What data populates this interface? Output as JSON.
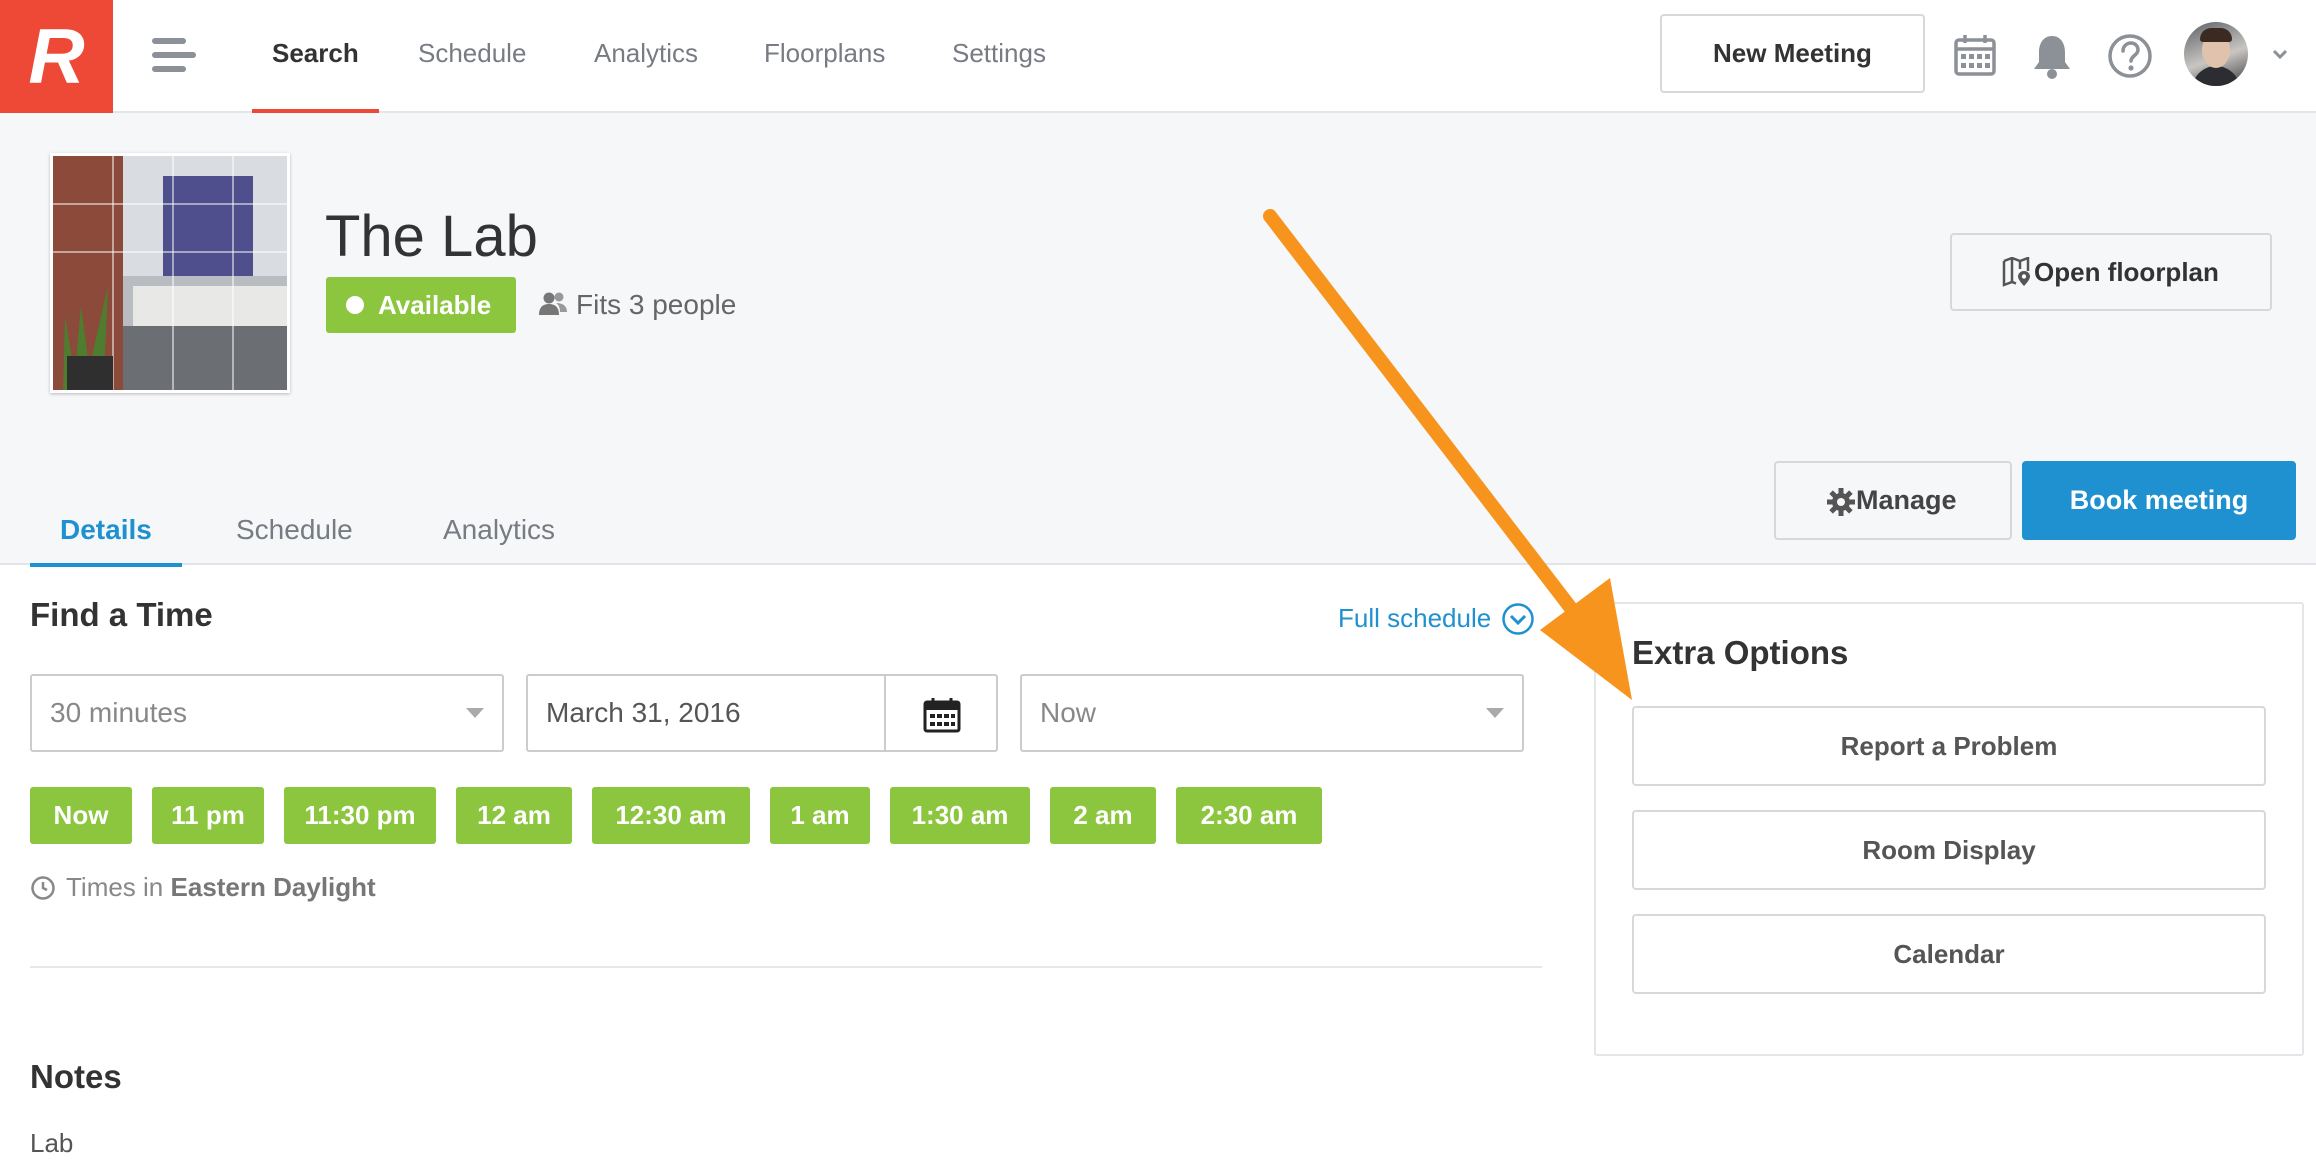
{
  "app": {
    "logo_letter": "R",
    "accent": "#ee4836",
    "primary": "#1f91d0",
    "success": "#8cc63f"
  },
  "nav": {
    "links": [
      {
        "label": "Search",
        "active": true
      },
      {
        "label": "Schedule"
      },
      {
        "label": "Analytics"
      },
      {
        "label": "Floorplans"
      },
      {
        "label": "Settings"
      }
    ],
    "new_meeting": "New Meeting",
    "icons": [
      "calendar-icon",
      "bell-icon",
      "help-icon",
      "avatar",
      "chevron-down-icon"
    ]
  },
  "room": {
    "name": "The Lab",
    "status": "Available",
    "capacity": "Fits 3 people",
    "open_floorplan": "Open floorplan"
  },
  "tabs": [
    {
      "label": "Details",
      "active": true
    },
    {
      "label": "Schedule"
    },
    {
      "label": "Analytics"
    }
  ],
  "actions": {
    "manage": "Manage",
    "book": "Book meeting"
  },
  "find_time": {
    "title": "Find a Time",
    "full_schedule": "Full schedule",
    "duration": "30 minutes",
    "date": "March 31, 2016",
    "start": "Now",
    "slots": [
      "Now",
      "11 pm",
      "11:30 pm",
      "12 am",
      "12:30 am",
      "1 am",
      "1:30 am",
      "2 am",
      "2:30 am"
    ],
    "timezone_prefix": "Times in",
    "timezone": "Eastern Daylight"
  },
  "notes": {
    "title": "Notes",
    "body": "Lab"
  },
  "extra_options": {
    "title": "Extra Options",
    "buttons": [
      "Report a Problem",
      "Room Display",
      "Calendar"
    ]
  },
  "annotation": {
    "arrow_color": "#f7941d"
  }
}
